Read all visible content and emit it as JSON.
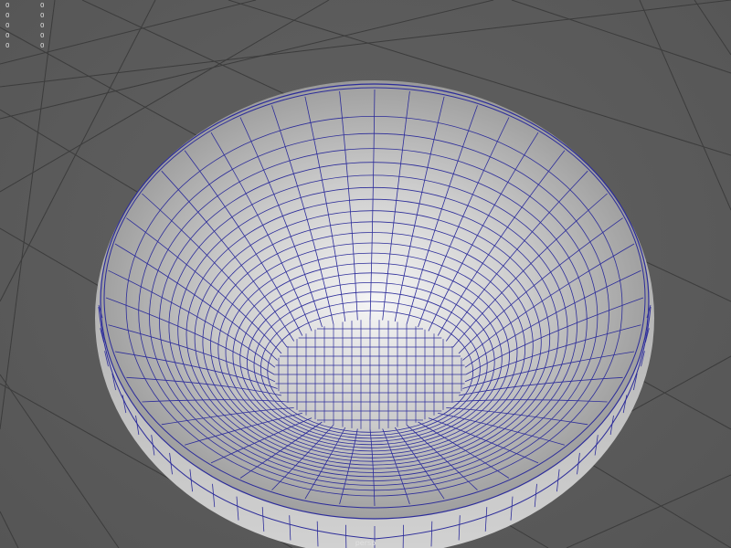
{
  "viewport": {
    "camera_name": "persp",
    "background_color": "#5c5c5c",
    "grid_color": "#3c3c3c",
    "wireframe_color": "#2c2c9a"
  },
  "hud": {
    "rows": [
      {
        "label": "0",
        "value": "0"
      },
      {
        "label": "0",
        "value": "0"
      },
      {
        "label": "0",
        "value": "0"
      },
      {
        "label": "0",
        "value": "0"
      },
      {
        "label": "0",
        "value": "0"
      }
    ]
  },
  "scene": {
    "object": "bowl-mesh",
    "display_mode": "wireframe-on-shaded"
  }
}
